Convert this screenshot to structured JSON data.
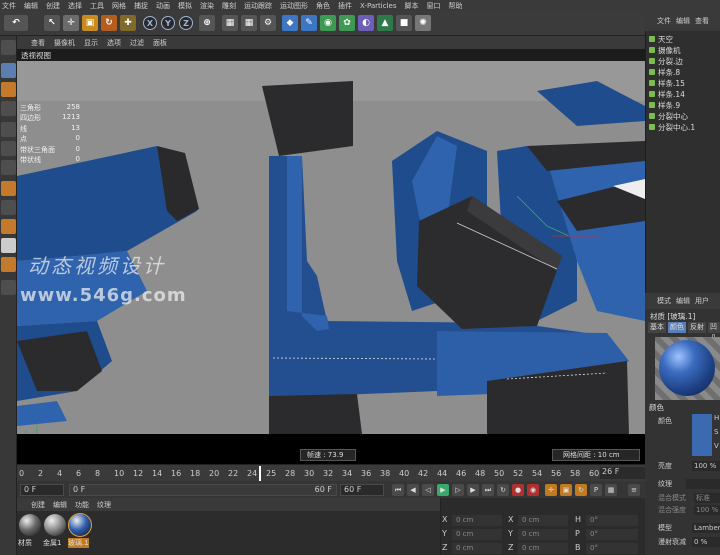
{
  "menubar": {
    "items": [
      "文件",
      "编辑",
      "创建",
      "选择",
      "工具",
      "网格",
      "捕捉",
      "动画",
      "模拟",
      "渲染",
      "雕刻",
      "运动跟踪",
      "运动图形",
      "角色",
      "插件",
      "X-Particles",
      "脚本",
      "窗口",
      "帮助"
    ]
  },
  "toolbar": {
    "axis_x": "X",
    "axis_y": "Y",
    "axis_z": "Z"
  },
  "viewport_menu": {
    "items": [
      "查看",
      "摄像机",
      "显示",
      "选项",
      "过滤",
      "面板"
    ],
    "title": "透视视图"
  },
  "stats": [
    {
      "label": "三角形",
      "value": "258"
    },
    {
      "label": "四边形",
      "value": "1213"
    },
    {
      "label": "线",
      "value": "13"
    },
    {
      "label": "点",
      "value": "0"
    },
    {
      "label": "带状三角面",
      "value": "0"
    },
    {
      "label": "带状线",
      "value": "0"
    }
  ],
  "watermark": {
    "line1": "动态视频设计",
    "line2": "www.546g.com"
  },
  "viewport_footer": {
    "fps": "帧速 : 73.9",
    "grid": "网格间距 : 10 cm"
  },
  "timeline": {
    "ticks": [
      "0",
      "2",
      "4",
      "6",
      "8",
      "10",
      "12",
      "14",
      "16",
      "18",
      "20",
      "22",
      "24",
      "25",
      "28",
      "30",
      "32",
      "34",
      "36",
      "38",
      "40",
      "42",
      "44",
      "46",
      "48",
      "50",
      "52",
      "54",
      "56",
      "58",
      "60"
    ],
    "current_frame": "26 F",
    "start_field": "0 F",
    "range_start": "0 F",
    "range_end": "60 F",
    "end_field": "60 F"
  },
  "material_manager": {
    "menu": [
      "创建",
      "编辑",
      "功能",
      "纹理"
    ],
    "materials": [
      {
        "label": "材质",
        "color": "#6a6a6a"
      },
      {
        "label": "金属1",
        "color": "#8c8c8c"
      },
      {
        "label": "玻璃.1",
        "color": "#2f5fb0"
      }
    ]
  },
  "coordinates": {
    "rows": [
      {
        "a": "X",
        "av": "0 cm",
        "b": "X",
        "bv": "0 cm",
        "c": "H",
        "cv": "0°"
      },
      {
        "a": "Y",
        "av": "0 cm",
        "b": "Y",
        "bv": "0 cm",
        "c": "P",
        "cv": "0°"
      },
      {
        "a": "Z",
        "av": "0 cm",
        "b": "Z",
        "bv": "0 cm",
        "c": "B",
        "cv": "0°"
      }
    ]
  },
  "object_manager": {
    "menu": [
      "文件",
      "编辑",
      "查看"
    ],
    "objects": [
      "天空",
      "摄像机",
      "分裂.边",
      "样条.8",
      "样条.15",
      "样条.14",
      "样条.9",
      "分裂中心",
      "分裂中心.1"
    ]
  },
  "attribute_manager": {
    "menu": [
      "模式",
      "编辑",
      "用户"
    ],
    "material_name": "材质 [玻璃.1]",
    "tabs": [
      "基本",
      "颜色",
      "反射",
      "凹凸"
    ],
    "section": "颜色",
    "color_label": "颜色",
    "hsv": [
      "H",
      "S",
      "V"
    ],
    "brightness_label": "亮度",
    "brightness_value": "100 %",
    "texture_label": "纹理",
    "blend_mode_label": "混合模式",
    "blend_mode_value": "标准",
    "blend_strength_label": "混合强度",
    "blend_strength_value": "100 %",
    "model_label": "模型",
    "model_value": "Lambert",
    "diffuse_label": "漫射衰减",
    "diffuse_value": "0 %"
  },
  "colors": {
    "accent_blue": "#2f5fb0",
    "viewport_gray": "#8c8c8c"
  }
}
